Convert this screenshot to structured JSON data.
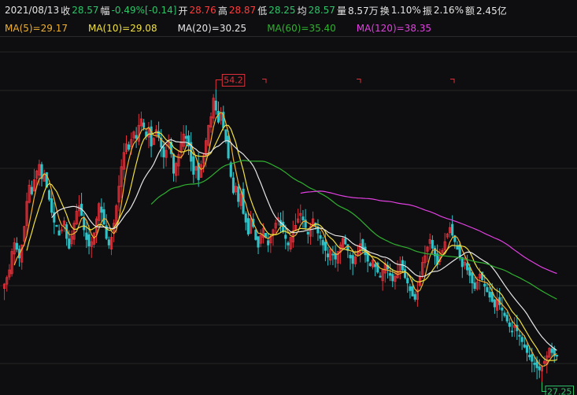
{
  "header": {
    "date": "2021/08/13",
    "close_label": "收",
    "close": "28.57",
    "change_label": "幅",
    "change": "-0.49%[-0.14]",
    "open_label": "开",
    "open": "28.76",
    "high_label": "高",
    "high": "28.87",
    "low_label": "低",
    "low": "28.25",
    "avg_label": "均",
    "avg": "28.57",
    "volume_label": "量",
    "volume": "8.57万",
    "turnover_label": "换",
    "turnover": "1.10%",
    "amplitude_label": "振",
    "amplitude": "2.16%",
    "amount_label": "额",
    "amount": "2.45亿"
  },
  "ma_legend": {
    "ma5": "MA(5)=29.17",
    "ma10": "MA(10)=29.08",
    "ma20": "MA(20)=30.25",
    "ma60": "MA(60)=35.40",
    "ma120": "MA(120)=38.35"
  },
  "colors": {
    "up": "#e0303a",
    "down": "#2fc3c8",
    "ma5": "#f0b030",
    "ma10": "#f0e040",
    "ma20": "#e6e6e6",
    "ma60": "#30b030",
    "ma120": "#e040e0",
    "green_text": "#2fc36a",
    "red_text": "#ff3b3b",
    "grid": "#262626"
  },
  "chart_data": {
    "type": "candlestick",
    "y_range": [
      25.5,
      57.5
    ],
    "max_marker": "54.2",
    "min_marker": "27.25",
    "closes": [
      35.2,
      35.8,
      36.5,
      38.2,
      39.0,
      38.4,
      37.6,
      38.8,
      40.5,
      42.8,
      44.3,
      43.5,
      44.8,
      45.6,
      46.2,
      44.9,
      45.3,
      44.1,
      43.0,
      41.8,
      40.9,
      40.5,
      39.7,
      40.2,
      41.0,
      39.4,
      38.5,
      39.6,
      40.8,
      41.9,
      42.4,
      41.5,
      40.2,
      39.3,
      38.7,
      39.1,
      39.9,
      41.2,
      42.6,
      41.8,
      40.7,
      39.4,
      38.8,
      39.5,
      40.8,
      42.4,
      44.2,
      46.0,
      47.3,
      48.1,
      47.6,
      48.5,
      49.2,
      48.6,
      49.8,
      50.4,
      49.6,
      48.8,
      49.5,
      47.9,
      48.6,
      49.4,
      48.7,
      47.8,
      46.9,
      47.5,
      48.3,
      47.2,
      45.4,
      46.3,
      47.1,
      48.2,
      49.0,
      48.6,
      47.9,
      46.5,
      45.3,
      46.0,
      44.8,
      46.2,
      47.0,
      48.4,
      49.8,
      50.6,
      52.3,
      51.2,
      50.1,
      50.8,
      49.6,
      48.4,
      46.8,
      45.1,
      43.6,
      44.2,
      42.8,
      43.5,
      41.7,
      40.9,
      39.8,
      41.2,
      40.5,
      39.3,
      38.6,
      39.7,
      40.3,
      39.5,
      38.8,
      39.6,
      40.2,
      40.8,
      41.3,
      40.6,
      40.0,
      39.4,
      38.8,
      39.5,
      40.1,
      40.6,
      41.2,
      41.7,
      41.1,
      40.4,
      39.8,
      40.5,
      41.2,
      40.6,
      39.9,
      39.4,
      38.8,
      38.3,
      37.7,
      38.4,
      37.9,
      37.5,
      38.2,
      38.8,
      39.4,
      38.9,
      38.3,
      37.6,
      37.1,
      37.7,
      38.2,
      38.9,
      38.4,
      37.9,
      37.3,
      36.9,
      37.4,
      36.8,
      36.3,
      35.9,
      36.5,
      37.1,
      36.6,
      36.0,
      35.5,
      35.9,
      36.4,
      37.0,
      36.5,
      35.8,
      35.3,
      34.6,
      34.1,
      33.8,
      34.7,
      35.9,
      37.2,
      37.8,
      38.6,
      39.3,
      38.5,
      37.8,
      37.0,
      37.7,
      38.3,
      39.1,
      39.8,
      40.4,
      39.7,
      39.1,
      38.4,
      37.6,
      36.8,
      37.2,
      36.5,
      36.0,
      35.3,
      34.8,
      35.4,
      36.1,
      35.6,
      35.0,
      34.5,
      34.0,
      33.6,
      33.1,
      33.8,
      33.3,
      32.8,
      32.3,
      31.8,
      31.3,
      30.8,
      31.4,
      30.9,
      30.4,
      29.9,
      29.4,
      28.9,
      28.5,
      28.1,
      27.8,
      27.5,
      27.3,
      27.6,
      28.1,
      28.6,
      29.3,
      28.9,
      28.6,
      28.57
    ],
    "ma_lines_source": "computed from closes (5,10,20,60,120 periods)"
  }
}
